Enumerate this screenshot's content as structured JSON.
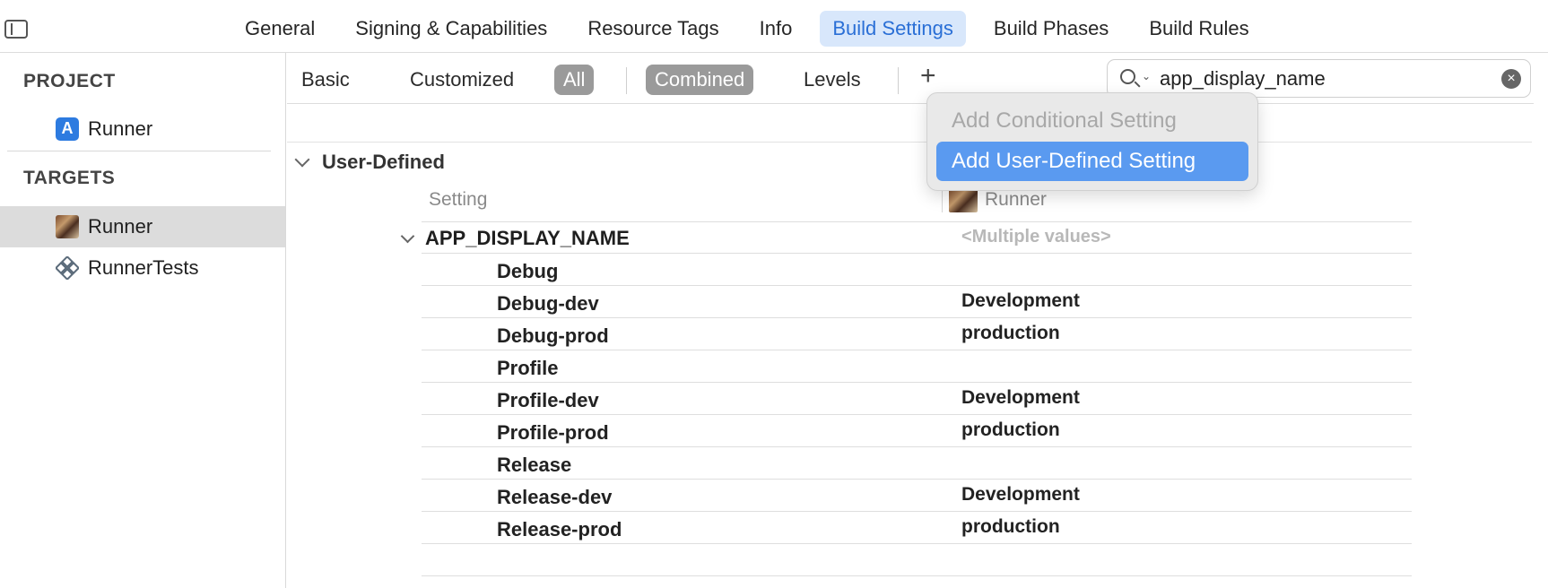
{
  "tabs": [
    "General",
    "Signing & Capabilities",
    "Resource Tags",
    "Info",
    "Build Settings",
    "Build Phases",
    "Build Rules"
  ],
  "active_tab": "Build Settings",
  "sidebar": {
    "project_header": "PROJECT",
    "project_item": "Runner",
    "targets_header": "TARGETS",
    "targets": [
      "Runner",
      "RunnerTests"
    ]
  },
  "filter": {
    "basic": "Basic",
    "customized": "Customized",
    "all": "All",
    "combined": "Combined",
    "levels": "Levels",
    "plus": "+"
  },
  "search": {
    "value": "app_display_name"
  },
  "popup": {
    "conditional": "Add Conditional Setting",
    "user_defined": "Add User-Defined Setting"
  },
  "section": {
    "title": "User-Defined",
    "col_setting": "Setting",
    "col_target": "Runner",
    "setting_name": "APP_DISPLAY_NAME",
    "multiple": "<Multiple values>",
    "rows": [
      {
        "config": "Debug",
        "value": ""
      },
      {
        "config": "Debug-dev",
        "value": "Development"
      },
      {
        "config": "Debug-prod",
        "value": "production"
      },
      {
        "config": "Profile",
        "value": ""
      },
      {
        "config": "Profile-dev",
        "value": "Development"
      },
      {
        "config": "Profile-prod",
        "value": "production"
      },
      {
        "config": "Release",
        "value": ""
      },
      {
        "config": "Release-dev",
        "value": "Development"
      },
      {
        "config": "Release-prod",
        "value": "production"
      }
    ]
  },
  "colors": {
    "accent": "#2a6fd6",
    "tab_active_bg": "#d8e7fb",
    "menu_highlight": "#5a9af0",
    "segment_selected": "#9a9a9a"
  }
}
